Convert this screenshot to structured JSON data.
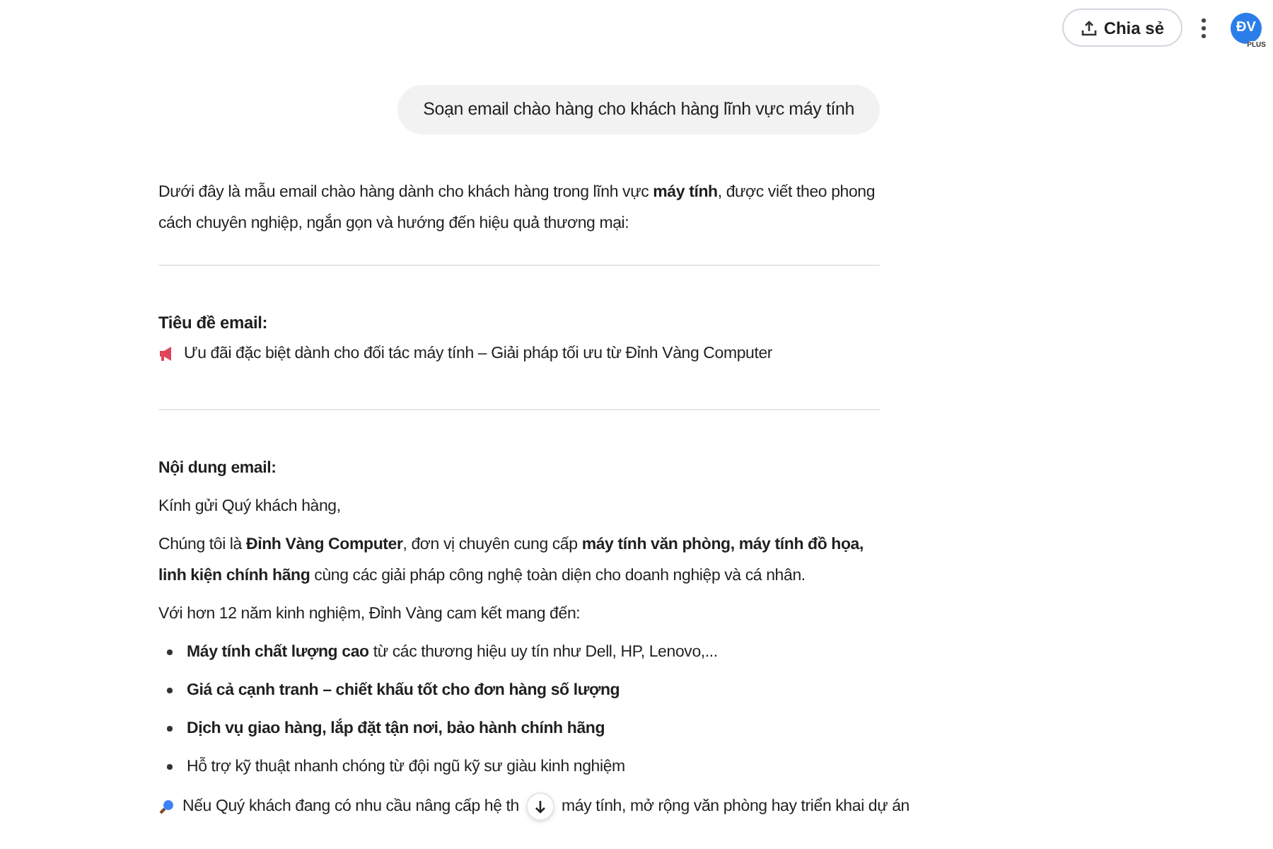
{
  "header": {
    "share_button": "Chia sẻ",
    "avatar": {
      "initials": "ĐV",
      "badge": "PLUS"
    }
  },
  "user_message": "Soạn email chào hàng cho khách hàng lĩnh vực máy tính",
  "intro": "Dưới đây là mẫu email chào hàng dành cho khách hàng trong lĩnh vực **máy tính**, được viết theo phong cách chuyên nghiệp, ngắn gọn và hướng đến hiệu quả thương mại:",
  "subject": {
    "heading": "Tiêu đề email:",
    "text": "Ưu đãi đặc biệt dành cho đối tác máy tính – Giải pháp tối ưu từ Đỉnh Vàng Computer"
  },
  "body": {
    "heading": "Nội dung email:",
    "paragraphs": [
      "Kính gửi Quý khách hàng,",
      "Chúng tôi là **Đỉnh Vàng Computer**, đơn vị chuyên cung cấp **máy tính văn phòng, máy tính đồ họa, linh kiện chính hãng** cùng các giải pháp công nghệ toàn diện cho doanh nghiệp và cá nhân.",
      "Với hơn 12 năm kinh nghiệm, Đỉnh Vàng cam kết mang đến:"
    ],
    "bullets": [
      "**Máy tính chất lượng cao** từ các thương hiệu uy tín như Dell, HP, Lenovo,...",
      "**Giá cả cạnh tranh – chiết khấu tốt cho đơn hàng số lượng**",
      "**Dịch vụ giao hàng, lắp đặt tận nơi, bảo hành chính hãng**",
      "Hỗ trợ kỹ thuật nhanh chóng từ đội ngũ kỹ sư giàu kinh nghiệm"
    ],
    "last_line": {
      "before": "Nếu Quý khách đang có nhu cầu nâng cấp hệ th",
      "after": "máy tính, mở rộng văn phòng hay triển khai dự án"
    }
  }
}
